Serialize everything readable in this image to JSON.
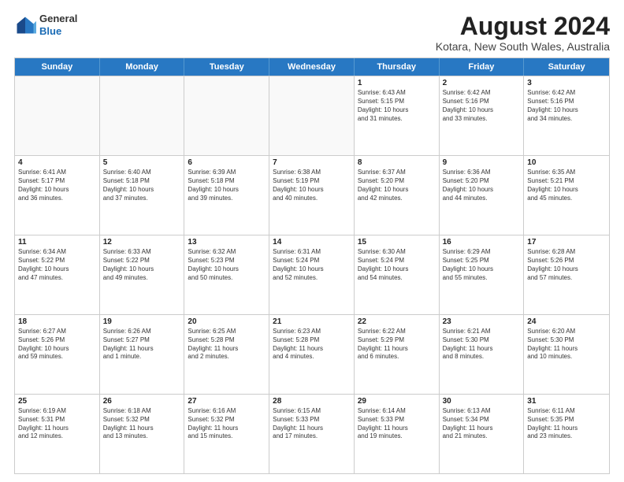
{
  "header": {
    "logo_line1": "General",
    "logo_line2": "Blue",
    "title": "August 2024",
    "location": "Kotara, New South Wales, Australia"
  },
  "days_of_week": [
    "Sunday",
    "Monday",
    "Tuesday",
    "Wednesday",
    "Thursday",
    "Friday",
    "Saturday"
  ],
  "weeks": [
    [
      {
        "day": "",
        "text": "",
        "empty": true
      },
      {
        "day": "",
        "text": "",
        "empty": true
      },
      {
        "day": "",
        "text": "",
        "empty": true
      },
      {
        "day": "",
        "text": "",
        "empty": true
      },
      {
        "day": "1",
        "text": "Sunrise: 6:43 AM\nSunset: 5:15 PM\nDaylight: 10 hours\nand 31 minutes.",
        "empty": false
      },
      {
        "day": "2",
        "text": "Sunrise: 6:42 AM\nSunset: 5:16 PM\nDaylight: 10 hours\nand 33 minutes.",
        "empty": false
      },
      {
        "day": "3",
        "text": "Sunrise: 6:42 AM\nSunset: 5:16 PM\nDaylight: 10 hours\nand 34 minutes.",
        "empty": false
      }
    ],
    [
      {
        "day": "4",
        "text": "Sunrise: 6:41 AM\nSunset: 5:17 PM\nDaylight: 10 hours\nand 36 minutes.",
        "empty": false
      },
      {
        "day": "5",
        "text": "Sunrise: 6:40 AM\nSunset: 5:18 PM\nDaylight: 10 hours\nand 37 minutes.",
        "empty": false
      },
      {
        "day": "6",
        "text": "Sunrise: 6:39 AM\nSunset: 5:18 PM\nDaylight: 10 hours\nand 39 minutes.",
        "empty": false
      },
      {
        "day": "7",
        "text": "Sunrise: 6:38 AM\nSunset: 5:19 PM\nDaylight: 10 hours\nand 40 minutes.",
        "empty": false
      },
      {
        "day": "8",
        "text": "Sunrise: 6:37 AM\nSunset: 5:20 PM\nDaylight: 10 hours\nand 42 minutes.",
        "empty": false
      },
      {
        "day": "9",
        "text": "Sunrise: 6:36 AM\nSunset: 5:20 PM\nDaylight: 10 hours\nand 44 minutes.",
        "empty": false
      },
      {
        "day": "10",
        "text": "Sunrise: 6:35 AM\nSunset: 5:21 PM\nDaylight: 10 hours\nand 45 minutes.",
        "empty": false
      }
    ],
    [
      {
        "day": "11",
        "text": "Sunrise: 6:34 AM\nSunset: 5:22 PM\nDaylight: 10 hours\nand 47 minutes.",
        "empty": false
      },
      {
        "day": "12",
        "text": "Sunrise: 6:33 AM\nSunset: 5:22 PM\nDaylight: 10 hours\nand 49 minutes.",
        "empty": false
      },
      {
        "day": "13",
        "text": "Sunrise: 6:32 AM\nSunset: 5:23 PM\nDaylight: 10 hours\nand 50 minutes.",
        "empty": false
      },
      {
        "day": "14",
        "text": "Sunrise: 6:31 AM\nSunset: 5:24 PM\nDaylight: 10 hours\nand 52 minutes.",
        "empty": false
      },
      {
        "day": "15",
        "text": "Sunrise: 6:30 AM\nSunset: 5:24 PM\nDaylight: 10 hours\nand 54 minutes.",
        "empty": false
      },
      {
        "day": "16",
        "text": "Sunrise: 6:29 AM\nSunset: 5:25 PM\nDaylight: 10 hours\nand 55 minutes.",
        "empty": false
      },
      {
        "day": "17",
        "text": "Sunrise: 6:28 AM\nSunset: 5:26 PM\nDaylight: 10 hours\nand 57 minutes.",
        "empty": false
      }
    ],
    [
      {
        "day": "18",
        "text": "Sunrise: 6:27 AM\nSunset: 5:26 PM\nDaylight: 10 hours\nand 59 minutes.",
        "empty": false
      },
      {
        "day": "19",
        "text": "Sunrise: 6:26 AM\nSunset: 5:27 PM\nDaylight: 11 hours\nand 1 minute.",
        "empty": false
      },
      {
        "day": "20",
        "text": "Sunrise: 6:25 AM\nSunset: 5:28 PM\nDaylight: 11 hours\nand 2 minutes.",
        "empty": false
      },
      {
        "day": "21",
        "text": "Sunrise: 6:23 AM\nSunset: 5:28 PM\nDaylight: 11 hours\nand 4 minutes.",
        "empty": false
      },
      {
        "day": "22",
        "text": "Sunrise: 6:22 AM\nSunset: 5:29 PM\nDaylight: 11 hours\nand 6 minutes.",
        "empty": false
      },
      {
        "day": "23",
        "text": "Sunrise: 6:21 AM\nSunset: 5:30 PM\nDaylight: 11 hours\nand 8 minutes.",
        "empty": false
      },
      {
        "day": "24",
        "text": "Sunrise: 6:20 AM\nSunset: 5:30 PM\nDaylight: 11 hours\nand 10 minutes.",
        "empty": false
      }
    ],
    [
      {
        "day": "25",
        "text": "Sunrise: 6:19 AM\nSunset: 5:31 PM\nDaylight: 11 hours\nand 12 minutes.",
        "empty": false
      },
      {
        "day": "26",
        "text": "Sunrise: 6:18 AM\nSunset: 5:32 PM\nDaylight: 11 hours\nand 13 minutes.",
        "empty": false
      },
      {
        "day": "27",
        "text": "Sunrise: 6:16 AM\nSunset: 5:32 PM\nDaylight: 11 hours\nand 15 minutes.",
        "empty": false
      },
      {
        "day": "28",
        "text": "Sunrise: 6:15 AM\nSunset: 5:33 PM\nDaylight: 11 hours\nand 17 minutes.",
        "empty": false
      },
      {
        "day": "29",
        "text": "Sunrise: 6:14 AM\nSunset: 5:33 PM\nDaylight: 11 hours\nand 19 minutes.",
        "empty": false
      },
      {
        "day": "30",
        "text": "Sunrise: 6:13 AM\nSunset: 5:34 PM\nDaylight: 11 hours\nand 21 minutes.",
        "empty": false
      },
      {
        "day": "31",
        "text": "Sunrise: 6:11 AM\nSunset: 5:35 PM\nDaylight: 11 hours\nand 23 minutes.",
        "empty": false
      }
    ]
  ]
}
